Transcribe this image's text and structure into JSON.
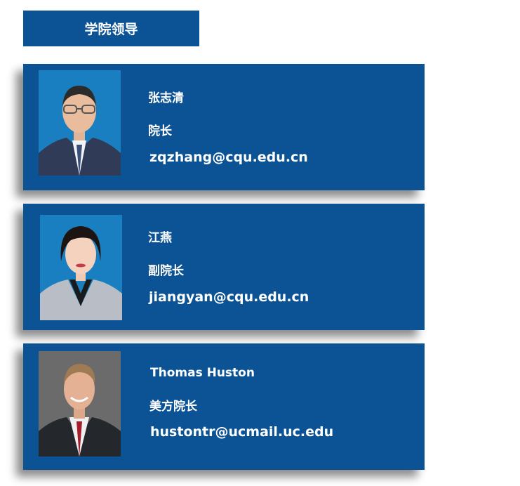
{
  "section": {
    "title": "学院领导"
  },
  "leaders": [
    {
      "name": "张志清",
      "title": "院长",
      "email": "zqzhang@cqu.edu.cn"
    },
    {
      "name": "江燕",
      "title": "副院长",
      "email": "jiangyan@cqu.edu.cn"
    },
    {
      "name": "Thomas Huston",
      "title": "美方院长",
      "email": "hustontr@ucmail.uc.edu"
    }
  ],
  "colors": {
    "accent": "#0b5395",
    "text": "#ffffff",
    "photo_bg_blue": "#1a7fc0",
    "photo_bg_gray": "#6b6b6b"
  }
}
